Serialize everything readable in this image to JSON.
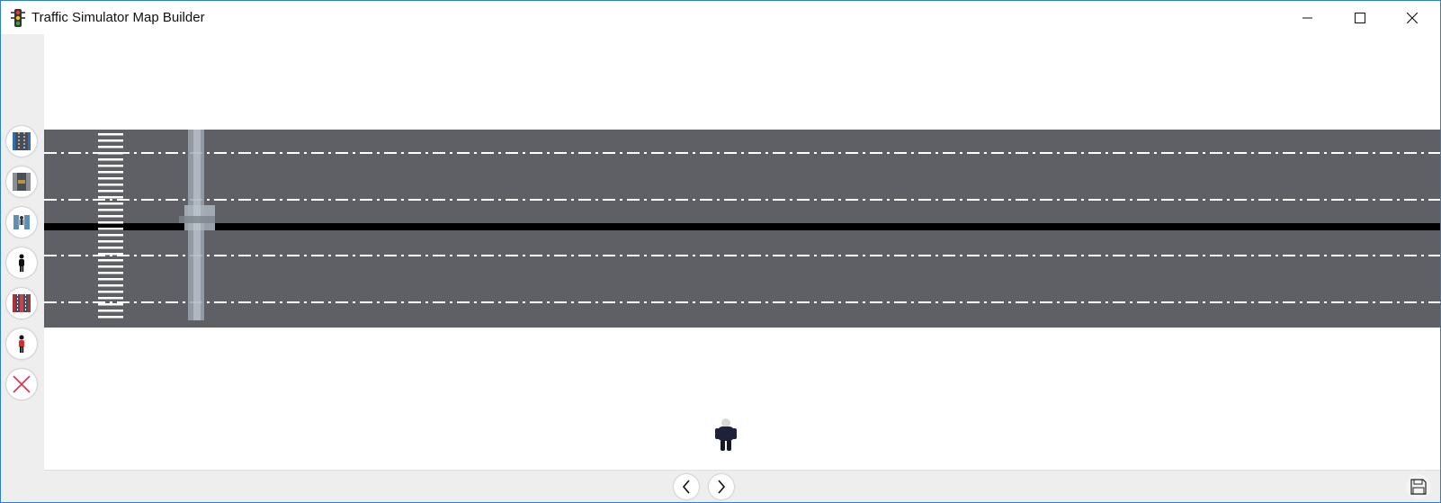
{
  "window": {
    "title": "Traffic Simulator Map Builder",
    "app_icon": "traffic-light-icon",
    "controls": [
      "minimize-icon",
      "maximize-icon",
      "close-icon"
    ]
  },
  "toolbar": {
    "tools": [
      {
        "name": "road-lanes-tool",
        "icon": "road-icon"
      },
      {
        "name": "road-intersection-tool",
        "icon": "road-crossing-icon"
      },
      {
        "name": "pedestrian-bridge-tool",
        "icon": "overpass-icon"
      },
      {
        "name": "pedestrian-tool",
        "icon": "person-icon"
      },
      {
        "name": "road-lanes-red-tool",
        "icon": "road-red-icon"
      },
      {
        "name": "pedestrian-red-tool",
        "icon": "person-red-icon"
      },
      {
        "name": "delete-tool",
        "icon": "delete-x-icon"
      }
    ]
  },
  "map": {
    "road_color": "#5f6065",
    "median_color": "#000000",
    "lane_marking_color": "#ffffff",
    "lanes": 6,
    "features": [
      "zebra-crossing",
      "pedestrian-overpass",
      "pedestrian-figure"
    ]
  },
  "bottom_bar": {
    "prev": "chevron-left-icon",
    "next": "chevron-right-icon",
    "save": "save-icon"
  }
}
